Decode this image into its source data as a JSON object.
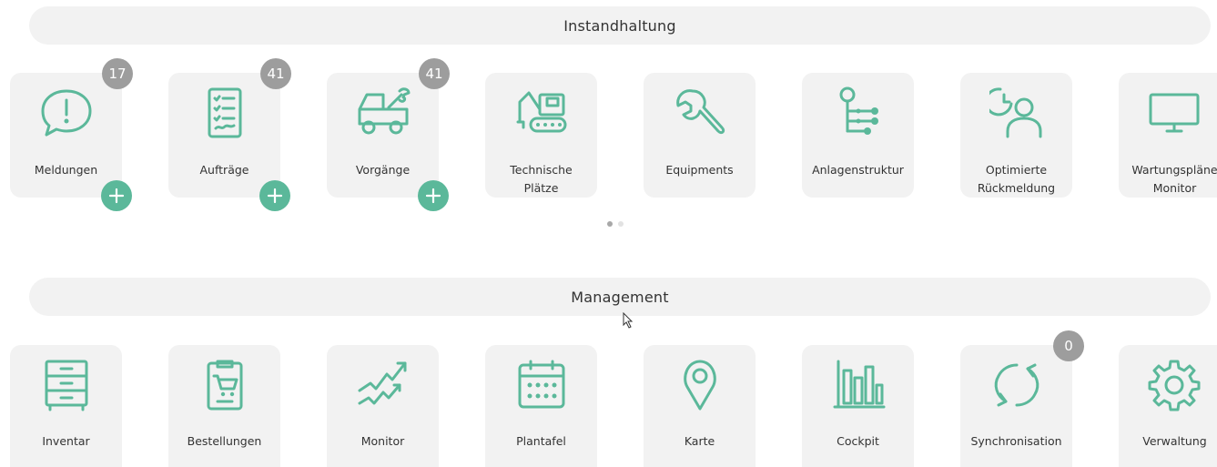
{
  "sections": [
    {
      "title": "Instandhaltung",
      "tiles": [
        {
          "label": "Meldungen",
          "icon": "exclamation-bubble-icon",
          "badge": "17",
          "add": true
        },
        {
          "label": "Aufträge",
          "icon": "checklist-icon",
          "badge": "41",
          "add": true
        },
        {
          "label": "Vorgänge",
          "icon": "truck-wrench-icon",
          "badge": "41",
          "add": true
        },
        {
          "label": "Technische\nPlätze",
          "icon": "excavator-icon"
        },
        {
          "label": "Equipments",
          "icon": "wrench-icon"
        },
        {
          "label": "Anlagenstruktur",
          "icon": "hierarchy-icon"
        },
        {
          "label": "Optimierte\nRückmeldung",
          "icon": "clock-user-icon"
        },
        {
          "label": "Wartungspläne\nMonitor",
          "icon": "monitor-icon"
        }
      ]
    },
    {
      "title": "Management",
      "tiles": [
        {
          "label": "Inventar",
          "icon": "cabinet-icon"
        },
        {
          "label": "Bestellungen",
          "icon": "clipboard-cart-icon"
        },
        {
          "label": "Monitor",
          "icon": "trend-chart-icon"
        },
        {
          "label": "Plantafel",
          "icon": "calendar-icon"
        },
        {
          "label": "Karte",
          "icon": "map-pin-icon"
        },
        {
          "label": "Cockpit",
          "icon": "bar-chart-icon"
        },
        {
          "label": "Synchronisation",
          "icon": "sync-icon",
          "badge": "0"
        },
        {
          "label": "Verwaltung",
          "icon": "gear-icon"
        }
      ]
    }
  ],
  "pagination": {
    "pages": 2,
    "active": 0
  },
  "colors": {
    "accent": "#5bb89a",
    "badge": "#9d9d9d",
    "tile": "#f2f2f2"
  }
}
